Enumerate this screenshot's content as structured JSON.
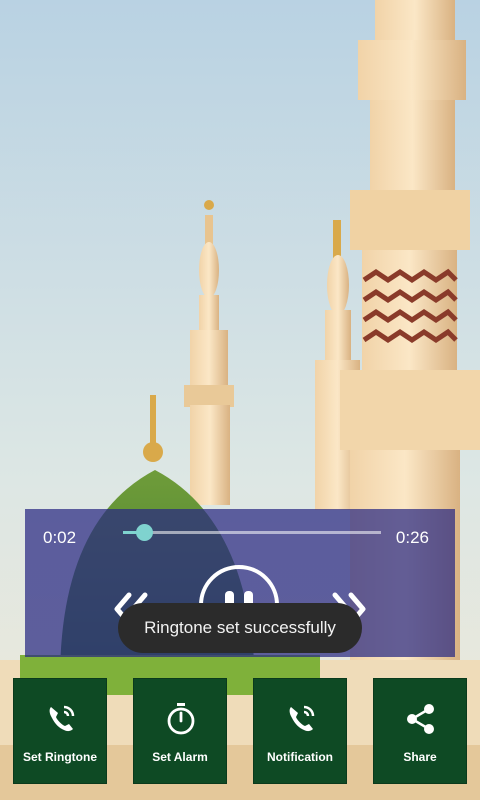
{
  "player": {
    "elapsed": "0:02",
    "total": "0:26",
    "progress": 0.08
  },
  "toast": {
    "message": "Ringtone set successfully"
  },
  "actions": [
    {
      "label": "Set Ringtone",
      "icon": "phone-ring-icon"
    },
    {
      "label": "Set Alarm",
      "icon": "stopwatch-icon"
    },
    {
      "label": "Notification",
      "icon": "phone-ring-icon"
    },
    {
      "label": "Share",
      "icon": "share-icon"
    }
  ],
  "colors": {
    "accent": "#7fd3cf",
    "button_bg": "#0e4a24",
    "player_overlay": "#282882",
    "toast_bg": "#2b2b2b"
  }
}
